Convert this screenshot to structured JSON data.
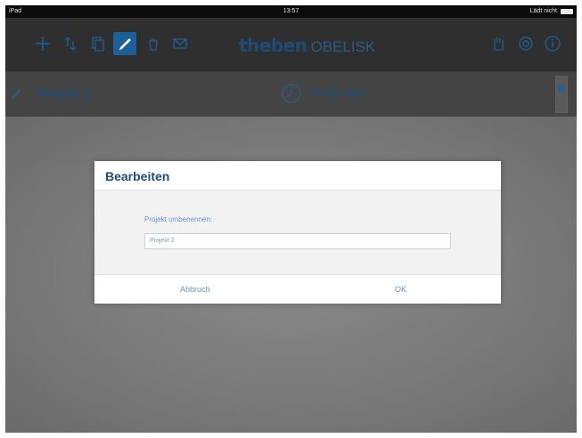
{
  "statusbar": {
    "device": "iPad",
    "time": "13:57",
    "charging": "Lädt nicht"
  },
  "toolbar": {
    "icons": [
      "add-icon",
      "transfer-icon",
      "copy-icon",
      "edit-icon",
      "bucket-icon",
      "mail-icon",
      "hand-icon",
      "settings-icon",
      "info-icon"
    ],
    "active_icon": "edit-icon",
    "brand_name": "theben",
    "product_name": "OBELISK"
  },
  "project": {
    "name": "Projekt 2",
    "device": "TR 612 top3"
  },
  "dialog": {
    "title": "Bearbeiten",
    "label": "Projekt umbenennen:",
    "input_value": "Projekt 2",
    "cancel_label": "Abbruch",
    "ok_label": "OK"
  },
  "colors": {
    "brand": "#1e4c77",
    "accent": "#1f5f97",
    "dialog_text": "#6c93b8"
  }
}
